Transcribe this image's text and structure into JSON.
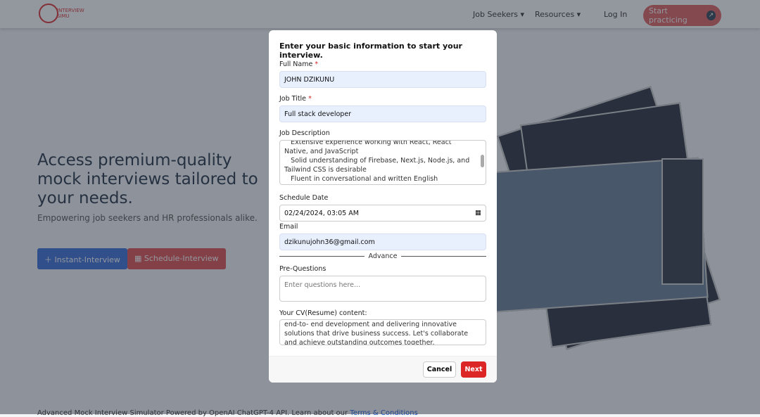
{
  "nav": {
    "logo_text": "INTERVIEW SIMU",
    "items": [
      "Job Seekers",
      "Resources"
    ],
    "login": "Log In",
    "start": "Start practicing"
  },
  "hero": {
    "title": "Access premium-quality mock interviews tailored to your needs.",
    "subtitle": "Empowering job seekers and HR professionals alike.",
    "instant": "Instant-Interview",
    "schedule": "Schedule-Interview"
  },
  "footer": {
    "text": "Advanced Mock Interview Simulator Powered by OpenAI ChatGPT-4 API. Learn about our ",
    "link": "Terms & Conditions"
  },
  "modal": {
    "title": "Enter your basic information to start your interview.",
    "full_name_label": "Full Name",
    "full_name": "JOHN DZIKUNU",
    "job_title_label": "Job Title",
    "job_title": "Full stack developer",
    "job_desc_label": "Job Description",
    "job_desc": [
      "   Extensive experience working with React, React Native, and JavaScript",
      "   Solid understanding of Firebase, Next.js, Node.js, and Tailwind CSS is desirable",
      "   Fluent in conversational and written English"
    ],
    "date_label": "Schedule Date",
    "date": "02/24/2024, 03:05 AM",
    "email_label": "Email",
    "email": "dzikunujohn36@gmail.com",
    "advance": "Advance",
    "preq_label": "Pre-Questions",
    "preq_placeholder": "Enter questions here...",
    "cv_label": "Your CV(Resume) content:",
    "cv": "end-to- end development and delivering innovative solutions that drive business success. Let's collaborate and achieve outstanding outcomes together.",
    "cancel": "Cancel",
    "next": "Next",
    "required": "*"
  },
  "colors": {
    "accent": "#dc2626",
    "primary_blue": "#3b6fd6",
    "input_fill": "#e8f0fe"
  }
}
